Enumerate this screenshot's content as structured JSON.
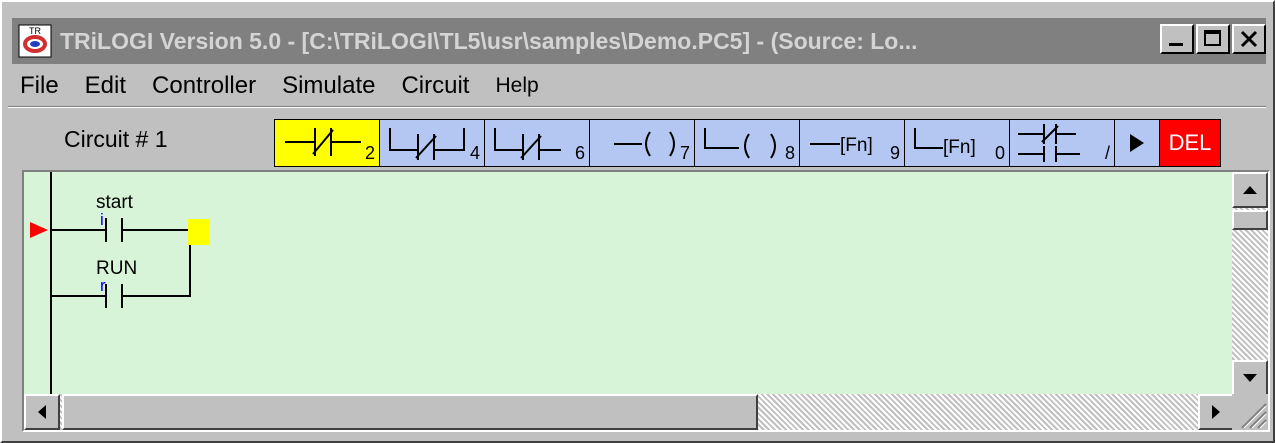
{
  "window": {
    "title": "TRiLOGI Version 5.0 - [C:\\TRiLOGI\\TL5\\usr\\samples\\Demo.PC5] - (Source: Lo...",
    "icon": "trilogi-app-icon"
  },
  "menu": {
    "file": "File",
    "edit": "Edit",
    "controller": "Controller",
    "simulate": "Simulate",
    "circuit": "Circuit",
    "help": "Help"
  },
  "toolbar": {
    "circuit_label": "Circuit # 1",
    "tools": [
      {
        "name": "series-contact",
        "key": "2",
        "selected": true
      },
      {
        "name": "parallel-contact",
        "key": "4"
      },
      {
        "name": "branch-contact",
        "key": "6"
      },
      {
        "name": "coil",
        "key": "7"
      },
      {
        "name": "parallel-coil",
        "key": "8"
      },
      {
        "name": "function",
        "text": "[Fn]",
        "key": "9"
      },
      {
        "name": "parallel-function",
        "text": "[Fn]",
        "key": "0"
      },
      {
        "name": "nc-toggle",
        "key": "/"
      },
      {
        "name": "play",
        "icon": "play-icon"
      },
      {
        "name": "delete",
        "text": "DEL"
      }
    ]
  },
  "ladder": {
    "contacts": [
      {
        "label": "start",
        "type": "i"
      },
      {
        "label": "RUN",
        "type": "r"
      }
    ]
  },
  "colors": {
    "canvas_bg": "#d8f4d8",
    "selected_tool": "#ffff00",
    "tool_bg": "#b3c7f2",
    "delete_bg": "#ff0000",
    "rung_marker": "#ff0000",
    "coil_marker": "#ffff00"
  }
}
